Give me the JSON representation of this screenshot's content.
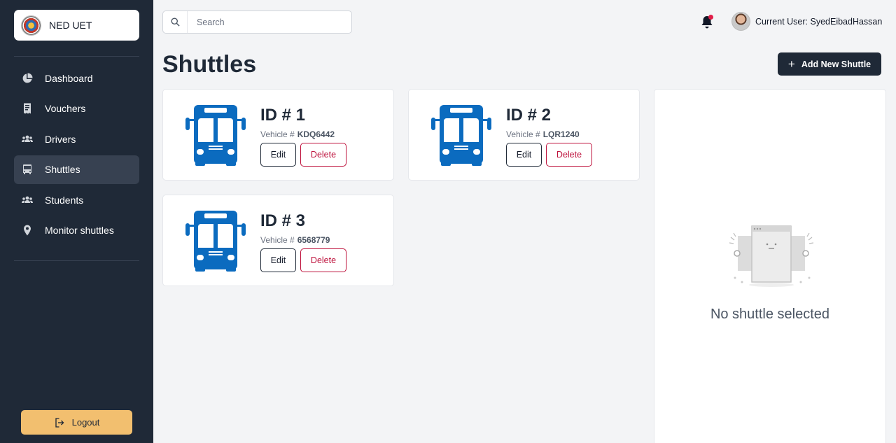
{
  "sidebar": {
    "brand": "NED UET",
    "items": [
      {
        "label": "Dashboard",
        "icon": "pie-chart-icon"
      },
      {
        "label": "Vouchers",
        "icon": "voucher-icon"
      },
      {
        "label": "Drivers",
        "icon": "users-icon"
      },
      {
        "label": "Shuttles",
        "icon": "bus-icon",
        "active": true
      },
      {
        "label": "Students",
        "icon": "users-icon"
      },
      {
        "label": "Monitor shuttles",
        "icon": "map-pin-icon"
      }
    ],
    "logout_label": "Logout"
  },
  "header": {
    "search_placeholder": "Search",
    "user_label": "Current User: SyedEibadHassan"
  },
  "main": {
    "title": "Shuttles",
    "add_button_label": "Add New Shuttle",
    "vehicle_prefix": "Vehicle #",
    "edit_label": "Edit",
    "delete_label": "Delete",
    "shuttles": [
      {
        "id_label": "ID # 1",
        "vehicle": "KDQ6442"
      },
      {
        "id_label": "ID # 2",
        "vehicle": "LQR1240"
      },
      {
        "id_label": "ID # 3",
        "vehicle": "6568779"
      }
    ],
    "empty_message": "No shuttle selected"
  },
  "colors": {
    "sidebar_bg": "#1f2937",
    "accent_logout": "#f2bf6f",
    "bus_blue": "#0b6bbf",
    "delete_red": "#be123c",
    "notification_dot": "#e11d48"
  }
}
